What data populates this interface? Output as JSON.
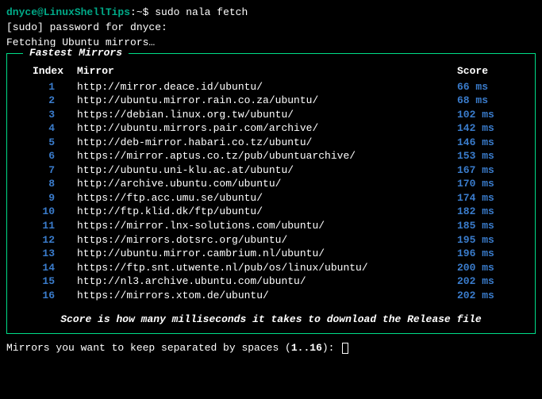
{
  "prompt": {
    "user_host": "dnyce@LinuxShellTips",
    "path_symbol": ":~$",
    "command": "sudo nala fetch"
  },
  "sudo_line": "[sudo] password for dnyce:",
  "fetch_line": "Fetching Ubuntu mirrors…",
  "box": {
    "title": "Fastest Mirrors",
    "headers": {
      "index": "Index",
      "mirror": "Mirror",
      "score": "Score"
    },
    "rows": [
      {
        "index": "1",
        "mirror": "http://mirror.deace.id/ubuntu/",
        "score": "66 ms"
      },
      {
        "index": "2",
        "mirror": "http://ubuntu.mirror.rain.co.za/ubuntu/",
        "score": "68 ms"
      },
      {
        "index": "3",
        "mirror": "https://debian.linux.org.tw/ubuntu/",
        "score": "102 ms"
      },
      {
        "index": "4",
        "mirror": "http://ubuntu.mirrors.pair.com/archive/",
        "score": "142 ms"
      },
      {
        "index": "5",
        "mirror": "http://deb-mirror.habari.co.tz/ubuntu/",
        "score": "146 ms"
      },
      {
        "index": "6",
        "mirror": "https://mirror.aptus.co.tz/pub/ubuntuarchive/",
        "score": "153 ms"
      },
      {
        "index": "7",
        "mirror": "http://ubuntu.uni-klu.ac.at/ubuntu/",
        "score": "167 ms"
      },
      {
        "index": "8",
        "mirror": "http://archive.ubuntu.com/ubuntu/",
        "score": "170 ms"
      },
      {
        "index": "9",
        "mirror": "https://ftp.acc.umu.se/ubuntu/",
        "score": "174 ms"
      },
      {
        "index": "10",
        "mirror": "http://ftp.klid.dk/ftp/ubuntu/",
        "score": "182 ms"
      },
      {
        "index": "11",
        "mirror": "https://mirror.lnx-solutions.com/ubuntu/",
        "score": "185 ms"
      },
      {
        "index": "12",
        "mirror": "https://mirrors.dotsrc.org/ubuntu/",
        "score": "195 ms"
      },
      {
        "index": "13",
        "mirror": "http://ubuntu.mirror.cambrium.nl/ubuntu/",
        "score": "196 ms"
      },
      {
        "index": "14",
        "mirror": "https://ftp.snt.utwente.nl/pub/os/linux/ubuntu/",
        "score": "200 ms"
      },
      {
        "index": "15",
        "mirror": "http://nl3.archive.ubuntu.com/ubuntu/",
        "score": "202 ms"
      },
      {
        "index": "16",
        "mirror": "https://mirrors.xtom.de/ubuntu/",
        "score": "202 ms"
      }
    ],
    "footer": "Score is how many milliseconds it takes to download the Release file"
  },
  "final": {
    "text_before": "Mirrors you want to keep separated by spaces (",
    "range": "1..16",
    "text_after": "): "
  }
}
